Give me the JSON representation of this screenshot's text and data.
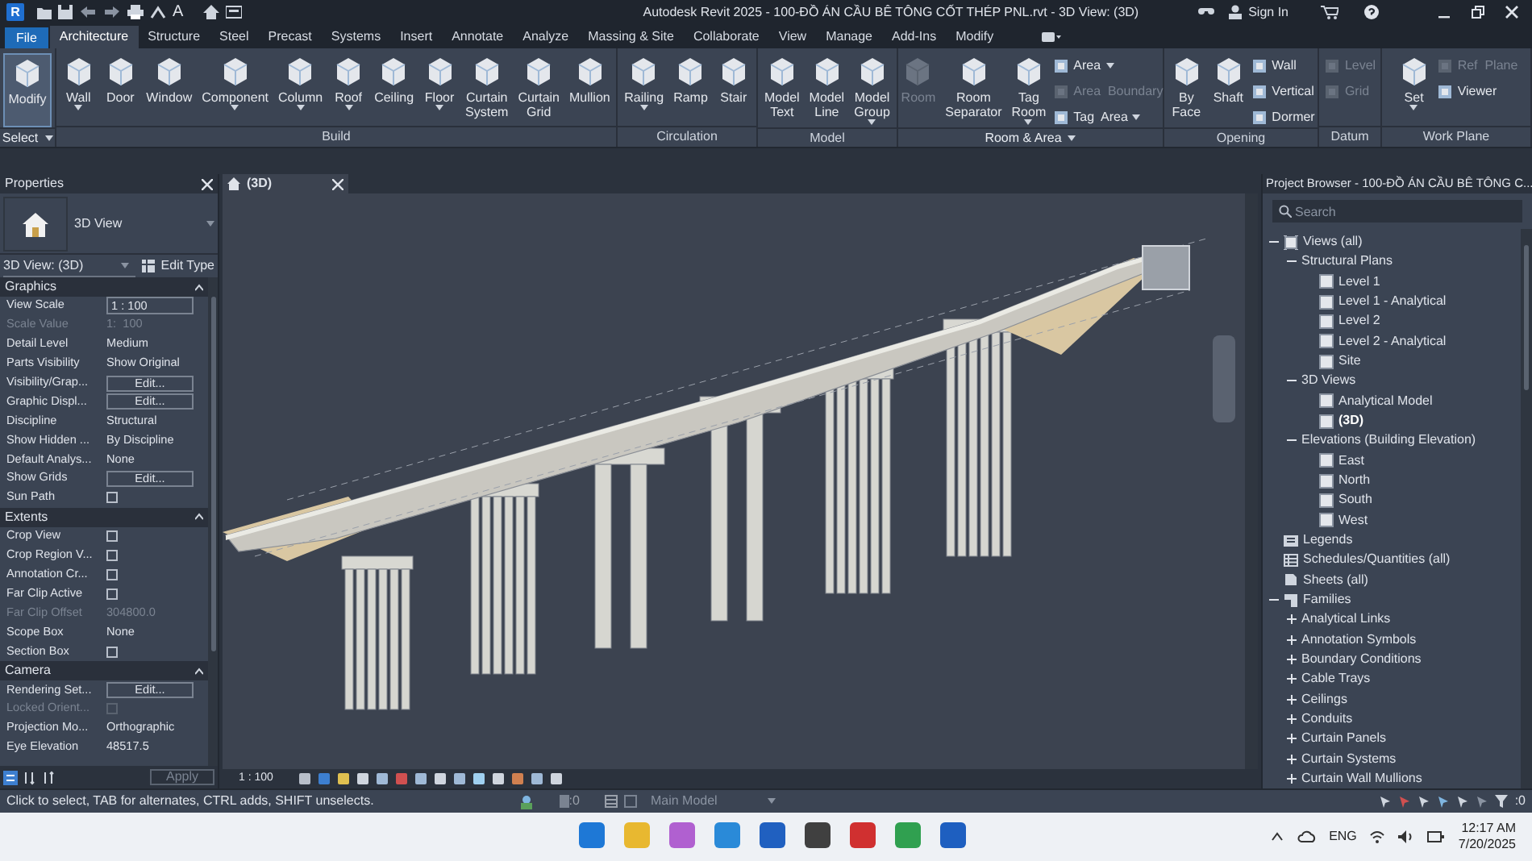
{
  "title_bar": {
    "app_logo": "R",
    "text_tool": "A",
    "title": "Autodesk Revit 2025 - 100-ĐỒ ÁN CẦU BÊ TÔNG CỐT THÉP PNL.rvt - 3D View: (3D)",
    "sign_in": "Sign In"
  },
  "ribbon_tabs": [
    {
      "label": "File",
      "selected": false,
      "kind": "file"
    },
    {
      "label": "Architecture",
      "selected": true,
      "kind": "tab"
    },
    {
      "label": "Structure",
      "selected": false,
      "kind": "tab"
    },
    {
      "label": "Steel",
      "selected": false,
      "kind": "tab"
    },
    {
      "label": "Precast",
      "selected": false,
      "kind": "tab"
    },
    {
      "label": "Systems",
      "selected": false,
      "kind": "tab"
    },
    {
      "label": "Insert",
      "selected": false,
      "kind": "tab"
    },
    {
      "label": "Annotate",
      "selected": false,
      "kind": "tab"
    },
    {
      "label": "Analyze",
      "selected": false,
      "kind": "tab"
    },
    {
      "label": "Massing & Site",
      "selected": false,
      "kind": "tab"
    },
    {
      "label": "Collaborate",
      "selected": false,
      "kind": "tab"
    },
    {
      "label": "View",
      "selected": false,
      "kind": "tab"
    },
    {
      "label": "Manage",
      "selected": false,
      "kind": "tab"
    },
    {
      "label": "Add-Ins",
      "selected": false,
      "kind": "tab"
    },
    {
      "label": "Modify",
      "selected": false,
      "kind": "tab"
    }
  ],
  "ribbon_panels": [
    {
      "title": "Select",
      "menu": true,
      "tools": [
        {
          "label": "Modify",
          "kind": "large",
          "selected": true,
          "disabled": false,
          "dropdown": false
        }
      ]
    },
    {
      "title": "Build",
      "menu": false,
      "tools": [
        {
          "label": "Wall",
          "kind": "large",
          "disabled": false,
          "dropdown": true
        },
        {
          "label": "Door",
          "kind": "large",
          "disabled": false,
          "dropdown": false
        },
        {
          "label": "Window",
          "kind": "large",
          "disabled": false,
          "dropdown": false
        },
        {
          "label": "Component",
          "kind": "large",
          "disabled": false,
          "dropdown": true
        },
        {
          "label": "Column",
          "kind": "large",
          "disabled": false,
          "dropdown": true
        },
        {
          "label": "Roof",
          "kind": "large",
          "disabled": false,
          "dropdown": true
        },
        {
          "label": "Ceiling",
          "kind": "large",
          "disabled": false,
          "dropdown": false
        },
        {
          "label": "Floor",
          "kind": "large",
          "disabled": false,
          "dropdown": true
        },
        {
          "label": "Curtain System",
          "kind": "large",
          "disabled": false,
          "dropdown": false
        },
        {
          "label": "Curtain Grid",
          "kind": "large",
          "disabled": false,
          "dropdown": false
        },
        {
          "label": "Mullion",
          "kind": "large",
          "disabled": false,
          "dropdown": false
        }
      ]
    },
    {
      "title": "Circulation",
      "menu": false,
      "tools": [
        {
          "label": "Railing",
          "kind": "large",
          "disabled": false,
          "dropdown": true
        },
        {
          "label": "Ramp",
          "kind": "large",
          "disabled": false,
          "dropdown": false
        },
        {
          "label": "Stair",
          "kind": "large",
          "disabled": false,
          "dropdown": false
        }
      ]
    },
    {
      "title": "Model",
      "menu": false,
      "tools": [
        {
          "label": "Model Text",
          "kind": "large",
          "disabled": false,
          "dropdown": false
        },
        {
          "label": "Model Line",
          "kind": "large",
          "disabled": false,
          "dropdown": false
        },
        {
          "label": "Model Group",
          "kind": "large",
          "disabled": false,
          "dropdown": true
        }
      ]
    },
    {
      "title": "Room & Area",
      "menu": true,
      "tools": [
        {
          "label": "Room",
          "kind": "large",
          "disabled": true,
          "dropdown": false
        },
        {
          "label": "Room Separator",
          "kind": "large",
          "disabled": false,
          "dropdown": false
        },
        {
          "label": "Tag Room",
          "kind": "large",
          "disabled": false,
          "dropdown": true
        },
        {
          "label": "Area",
          "kind": "small",
          "disabled": false,
          "dropdown": true
        },
        {
          "label": "Area  Boundary",
          "kind": "small",
          "disabled": true,
          "dropdown": false
        },
        {
          "label": "Tag  Area",
          "kind": "small",
          "disabled": false,
          "dropdown": true
        }
      ]
    },
    {
      "title": "Opening",
      "menu": false,
      "tools": [
        {
          "label": "By Face",
          "kind": "large",
          "disabled": false,
          "dropdown": false
        },
        {
          "label": "Shaft",
          "kind": "large",
          "disabled": false,
          "dropdown": false
        },
        {
          "label": "Wall",
          "kind": "small",
          "disabled": false,
          "dropdown": false
        },
        {
          "label": "Vertical",
          "kind": "small",
          "disabled": false,
          "dropdown": false
        },
        {
          "label": "Dormer",
          "kind": "small",
          "disabled": false,
          "dropdown": false
        }
      ]
    },
    {
      "title": "Datum",
      "menu": false,
      "tools": [
        {
          "label": "Level",
          "kind": "small",
          "disabled": true,
          "dropdown": false
        },
        {
          "label": "Grid",
          "kind": "small",
          "disabled": true,
          "dropdown": false
        }
      ]
    },
    {
      "title": "Work Plane",
      "menu": false,
      "tools": [
        {
          "label": "Set",
          "kind": "large",
          "disabled": false,
          "dropdown": true
        },
        {
          "label": "Ref  Plane",
          "kind": "small",
          "disabled": true,
          "dropdown": false
        },
        {
          "label": "Viewer",
          "kind": "small",
          "disabled": false,
          "dropdown": false
        }
      ]
    }
  ],
  "properties": {
    "title": "Properties",
    "type_name": "3D View",
    "instance": "3D View: (3D)",
    "edit_type": "Edit Type",
    "apply": "Apply",
    "groups": [
      {
        "title": "Graphics",
        "rows": [
          {
            "label": "View Scale",
            "value": "1 : 100",
            "kind": "input",
            "disabled": false
          },
          {
            "label": "Scale Value",
            "value": "1:  100",
            "kind": "text",
            "disabled": true
          },
          {
            "label": "Detail Level",
            "value": "Medium",
            "kind": "text",
            "disabled": false
          },
          {
            "label": "Parts Visibility",
            "value": "Show Original",
            "kind": "text",
            "disabled": false
          },
          {
            "label": "Visibility/Grap...",
            "value": "Edit...",
            "kind": "button",
            "disabled": false
          },
          {
            "label": "Graphic Displ...",
            "value": "Edit...",
            "kind": "button",
            "disabled": false
          },
          {
            "label": "Discipline",
            "value": "Structural",
            "kind": "text",
            "disabled": false
          },
          {
            "label": "Show Hidden ...",
            "value": "By Discipline",
            "kind": "text",
            "disabled": false
          },
          {
            "label": "Default Analys...",
            "value": "None",
            "kind": "text",
            "disabled": false
          },
          {
            "label": "Show Grids",
            "value": "Edit...",
            "kind": "button",
            "disabled": false
          },
          {
            "label": "Sun Path",
            "kind": "checkbox",
            "checked": false,
            "disabled": false
          }
        ]
      },
      {
        "title": "Extents",
        "rows": [
          {
            "label": "Crop View",
            "kind": "checkbox",
            "checked": false,
            "disabled": false
          },
          {
            "label": "Crop Region V...",
            "kind": "checkbox",
            "checked": false,
            "disabled": false
          },
          {
            "label": "Annotation Cr...",
            "kind": "checkbox",
            "checked": false,
            "disabled": false
          },
          {
            "label": "Far Clip Active",
            "kind": "checkbox",
            "checked": false,
            "disabled": false
          },
          {
            "label": "Far Clip Offset",
            "value": "304800.0",
            "kind": "text",
            "disabled": true
          },
          {
            "label": "Scope Box",
            "value": "None",
            "kind": "text",
            "disabled": false
          },
          {
            "label": "Section Box",
            "kind": "checkbox",
            "checked": false,
            "disabled": false
          }
        ]
      },
      {
        "title": "Camera",
        "rows": [
          {
            "label": "Rendering Set...",
            "value": "Edit...",
            "kind": "button",
            "disabled": false
          },
          {
            "label": "Locked Orient...",
            "kind": "checkbox",
            "checked": false,
            "disabled": true
          },
          {
            "label": "Projection Mo...",
            "value": "Orthographic",
            "kind": "text",
            "disabled": false
          },
          {
            "label": "Eye Elevation",
            "value": "48517.5",
            "kind": "text",
            "disabled": false
          }
        ]
      }
    ]
  },
  "view_tab": {
    "title": "(3D)"
  },
  "view_bar": {
    "scale": "1 : 100"
  },
  "project_browser": {
    "title": "Project Browser - 100-ĐỒ ÁN CẦU BÊ TÔNG C...",
    "search_placeholder": "Search",
    "tree": [
      {
        "label": "Views (all)",
        "kind": "views",
        "expanded": true,
        "children": [
          {
            "label": "Structural Plans",
            "kind": "category",
            "expanded": true,
            "children": [
              {
                "label": "Level 1",
                "kind": "view",
                "active": false
              },
              {
                "label": "Level 1 - Analytical",
                "kind": "view",
                "active": false
              },
              {
                "label": "Level 2",
                "kind": "view",
                "active": false
              },
              {
                "label": "Level 2 - Analytical",
                "kind": "view",
                "active": false
              },
              {
                "label": "Site",
                "kind": "view",
                "active": false
              }
            ]
          },
          {
            "label": "3D Views",
            "kind": "category",
            "expanded": true,
            "children": [
              {
                "label": "Analytical Model",
                "kind": "view",
                "active": false
              },
              {
                "label": "(3D)",
                "kind": "view",
                "active": true
              }
            ]
          },
          {
            "label": "Elevations (Building Elevation)",
            "kind": "category",
            "expanded": true,
            "children": [
              {
                "label": "East",
                "kind": "view",
                "active": false
              },
              {
                "label": "North",
                "kind": "view",
                "active": false
              },
              {
                "label": "South",
                "kind": "view",
                "active": false
              },
              {
                "label": "West",
                "kind": "view",
                "active": false
              }
            ]
          }
        ]
      },
      {
        "label": "Legends",
        "kind": "legend"
      },
      {
        "label": "Schedules/Quantities (all)",
        "kind": "schedule"
      },
      {
        "label": "Sheets (all)",
        "kind": "sheet"
      },
      {
        "label": "Families",
        "kind": "family",
        "expanded": true,
        "children": [
          {
            "label": "Analytical Links",
            "kind": "category",
            "expanded": false
          },
          {
            "label": "Annotation Symbols",
            "kind": "category",
            "expanded": false
          },
          {
            "label": "Boundary Conditions",
            "kind": "category",
            "expanded": false
          },
          {
            "label": "Cable Trays",
            "kind": "category",
            "expanded": false
          },
          {
            "label": "Ceilings",
            "kind": "category",
            "expanded": false
          },
          {
            "label": "Conduits",
            "kind": "category",
            "expanded": false
          },
          {
            "label": "Curtain Panels",
            "kind": "category",
            "expanded": false
          },
          {
            "label": "Curtain Systems",
            "kind": "category",
            "expanded": false
          },
          {
            "label": "Curtain Wall Mullions",
            "kind": "category",
            "expanded": false
          }
        ]
      }
    ]
  },
  "status_bar": {
    "message": "Click to select, TAB for alternates, CTRL adds, SHIFT unselects.",
    "workset_count": ":0",
    "model": "Main Model",
    "filter_count": ":0"
  },
  "taskbar": {
    "language": "ENG",
    "time": "12:17 AM",
    "date": "7/20/2025"
  }
}
